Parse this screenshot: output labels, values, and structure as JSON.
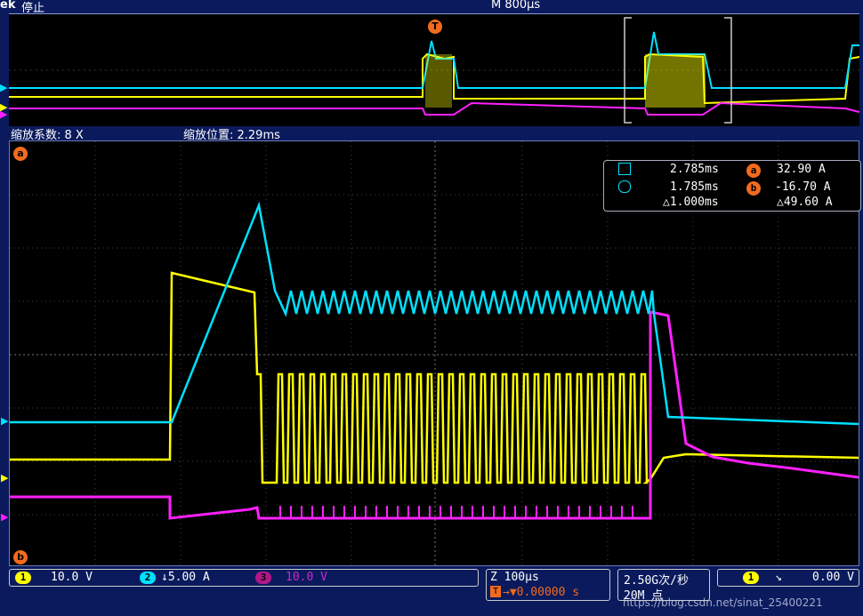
{
  "header": {
    "brand": "ek",
    "status": "停止",
    "timebase": "M 800µs"
  },
  "zoom": {
    "factor_label": "缩放系数: 8 X",
    "position_label": "缩放位置: 2.29ms"
  },
  "cursors": {
    "cursor1_time": "2.785ms",
    "cursor2_time": "1.785ms",
    "delta_time": "△1.000ms",
    "a_label": "a",
    "b_label": "b",
    "a_value": "32.90 A",
    "b_value": "-16.70 A",
    "delta_value": "△49.60 A"
  },
  "channels": [
    {
      "num": "1",
      "scale": "10.0 V",
      "color": "#ffff00"
    },
    {
      "num": "2",
      "scale": "↓5.00 A",
      "color": "#00e0ff"
    },
    {
      "num": "3",
      "scale": "10.0 V",
      "color": "#ff20ff"
    }
  ],
  "horizontal": {
    "zoom": "Z 100µs",
    "trigger_pos": "→▼0.00000 s"
  },
  "acquisition": {
    "rate": "2.50G次/秒",
    "points": "20M 点"
  },
  "trigger": {
    "source": "1",
    "slope": "↘",
    "level": "0.00 V"
  },
  "markers": {
    "trigger": "T",
    "cursor_a": "a",
    "cursor_b": "b"
  },
  "watermark": "https://blog.csdn.net/sinat_25400221",
  "colors": {
    "ch1": "#ffff00",
    "ch2": "#00e0ff",
    "ch3": "#ff20ff",
    "cursor": "#f26b1d",
    "bg": "#0a1a5c"
  }
}
